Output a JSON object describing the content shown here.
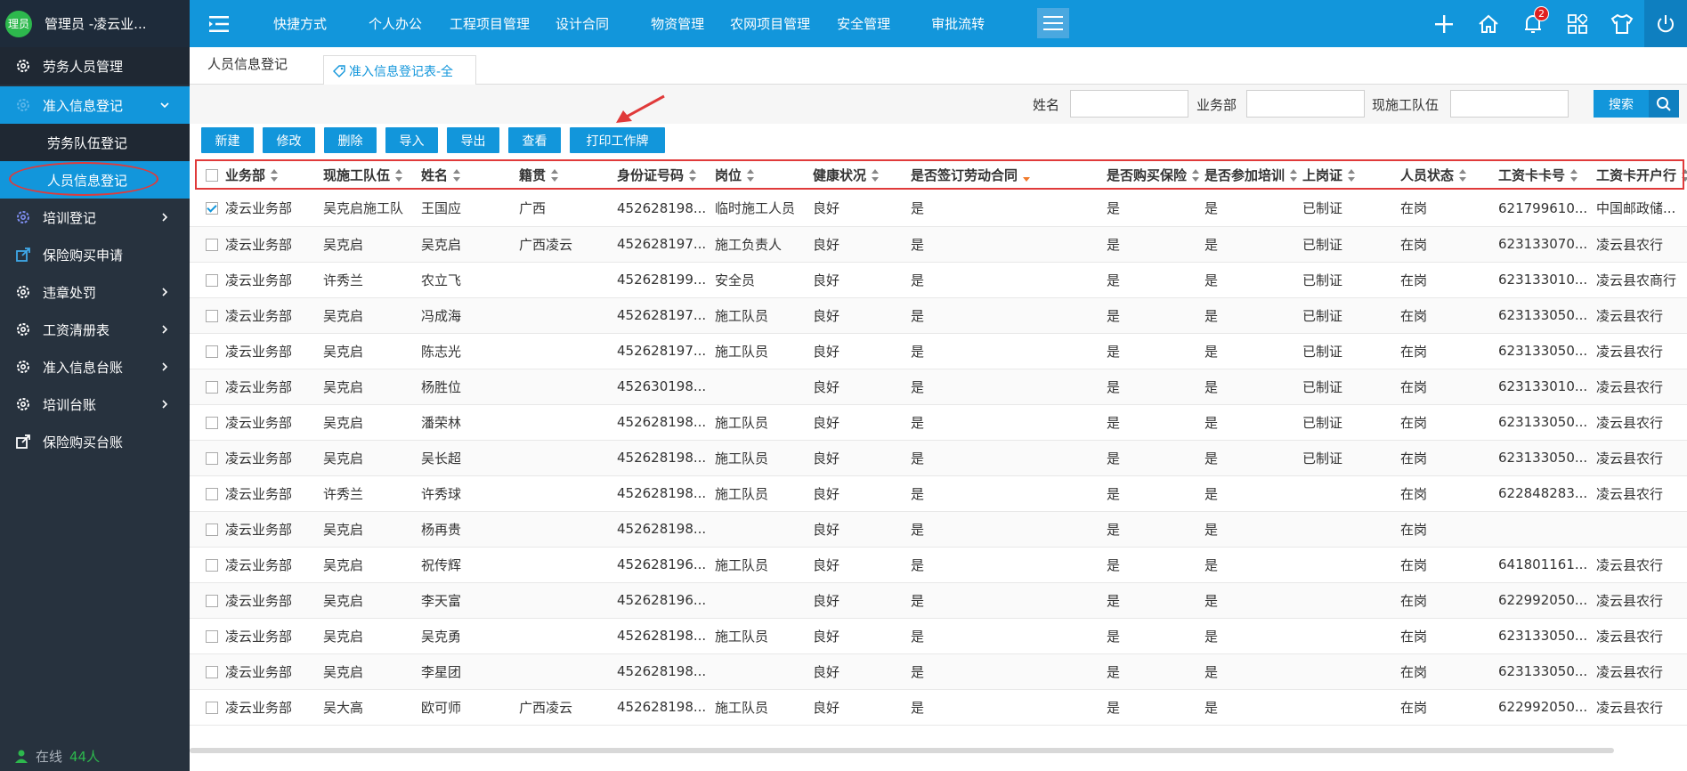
{
  "topbar": {
    "avatar_text": "理员",
    "user_name": "管理员 -凌云业...",
    "nav": [
      "快捷方式",
      "个人办公",
      "工程项目管理",
      "设计合同",
      "物资管理",
      "农网项目管理",
      "安全管理",
      "审批流转"
    ],
    "notification_count": "2",
    "brand_color": "#1296db"
  },
  "sidebar": {
    "items": [
      {
        "label": "劳务人员管理",
        "icon": "gear-icon"
      },
      {
        "label": "准入信息登记",
        "icon": "gear-icon"
      },
      {
        "label": "劳务队伍登记"
      },
      {
        "label": "人员信息登记"
      },
      {
        "label": "培训登记",
        "icon": "gear-icon"
      },
      {
        "label": "保险购买申请",
        "icon": "share-icon"
      },
      {
        "label": "违章处罚",
        "icon": "gear-icon"
      },
      {
        "label": "工资清册表",
        "icon": "gear-icon"
      },
      {
        "label": "准入信息台账",
        "icon": "gear-icon"
      },
      {
        "label": "培训台账",
        "icon": "gear-icon"
      },
      {
        "label": "保险购买台账",
        "icon": "share-icon"
      }
    ],
    "online_label": "在线",
    "online_count": "44人"
  },
  "tabs": {
    "tab1": "人员信息登记",
    "tab2": "准入信息登记表-全"
  },
  "filter": {
    "name_label": "姓名",
    "dept_label": "业务部",
    "team_label": "现施工队伍",
    "search_label": "搜索"
  },
  "toolbar": {
    "new": "新建",
    "edit": "修改",
    "delete": "删除",
    "import": "导入",
    "export": "导出",
    "view": "查看",
    "print": "打印工作牌"
  },
  "table": {
    "headers": [
      "业务部",
      "现施工队伍",
      "姓名",
      "籍贯",
      "身份证号码",
      "岗位",
      "健康状况",
      "是否签订劳动合同",
      "是否购买保险",
      "是否参加培训",
      "上岗证",
      "人员状态",
      "工资卡卡号",
      "工资卡开户行"
    ],
    "rows": [
      [
        "凌云业务部",
        "吴克启施工队",
        "王国应",
        "广西",
        "452628198...",
        "临时施工人员",
        "良好",
        "是",
        "是",
        "是",
        "已制证",
        "在岗",
        "621799610...",
        "中国邮政储..."
      ],
      [
        "凌云业务部",
        "吴克启",
        "吴克启",
        "广西凌云",
        "452628197...",
        "施工负责人",
        "良好",
        "是",
        "是",
        "是",
        "已制证",
        "在岗",
        "623133070...",
        "凌云县农行"
      ],
      [
        "凌云业务部",
        "许秀兰",
        "农立飞",
        "",
        "452628199...",
        "安全员",
        "良好",
        "是",
        "是",
        "是",
        "已制证",
        "在岗",
        "623133010...",
        "凌云县农商行"
      ],
      [
        "凌云业务部",
        "吴克启",
        "冯成海",
        "",
        "452628197...",
        "施工队员",
        "良好",
        "是",
        "是",
        "是",
        "已制证",
        "在岗",
        "623133050...",
        "凌云县农行"
      ],
      [
        "凌云业务部",
        "吴克启",
        "陈志光",
        "",
        "452628197...",
        "施工队员",
        "良好",
        "是",
        "是",
        "是",
        "已制证",
        "在岗",
        "623133050...",
        "凌云县农行"
      ],
      [
        "凌云业务部",
        "吴克启",
        "杨胜位",
        "",
        "452630198...",
        "",
        "良好",
        "是",
        "是",
        "是",
        "已制证",
        "在岗",
        "623133010...",
        "凌云县农行"
      ],
      [
        "凌云业务部",
        "吴克启",
        "潘荣林",
        "",
        "452628198...",
        "施工队员",
        "良好",
        "是",
        "是",
        "是",
        "已制证",
        "在岗",
        "623133050...",
        "凌云县农行"
      ],
      [
        "凌云业务部",
        "吴克启",
        "吴长超",
        "",
        "452628198...",
        "施工队员",
        "良好",
        "是",
        "是",
        "是",
        "已制证",
        "在岗",
        "623133050...",
        "凌云县农行"
      ],
      [
        "凌云业务部",
        "许秀兰",
        "许秀球",
        "",
        "452628198...",
        "施工队员",
        "良好",
        "是",
        "是",
        "是",
        "",
        "在岗",
        "622848283...",
        "凌云县农行"
      ],
      [
        "凌云业务部",
        "吴克启",
        "杨再贵",
        "",
        "452628198...",
        "",
        "良好",
        "是",
        "是",
        "是",
        "",
        "在岗",
        "",
        ""
      ],
      [
        "凌云业务部",
        "吴克启",
        "祝传辉",
        "",
        "452628196...",
        "施工队员",
        "良好",
        "是",
        "是",
        "是",
        "",
        "在岗",
        "641801161...",
        "凌云县农行"
      ],
      [
        "凌云业务部",
        "吴克启",
        "李天富",
        "",
        "452628196...",
        "",
        "良好",
        "是",
        "是",
        "是",
        "",
        "在岗",
        "622992050...",
        "凌云县农行"
      ],
      [
        "凌云业务部",
        "吴克启",
        "吴克勇",
        "",
        "452628198...",
        "施工队员",
        "良好",
        "是",
        "是",
        "是",
        "",
        "在岗",
        "623133050...",
        "凌云县农行"
      ],
      [
        "凌云业务部",
        "吴克启",
        "李星团",
        "",
        "452628198...",
        "",
        "良好",
        "是",
        "是",
        "是",
        "",
        "在岗",
        "623133050...",
        "凌云县农行"
      ],
      [
        "凌云业务部",
        "吴大高",
        "欧可师",
        "广西凌云",
        "452628198...",
        "施工队员",
        "良好",
        "是",
        "是",
        "是",
        "",
        "在岗",
        "622992050...",
        "凌云县农行"
      ]
    ],
    "checked_row": 0
  }
}
